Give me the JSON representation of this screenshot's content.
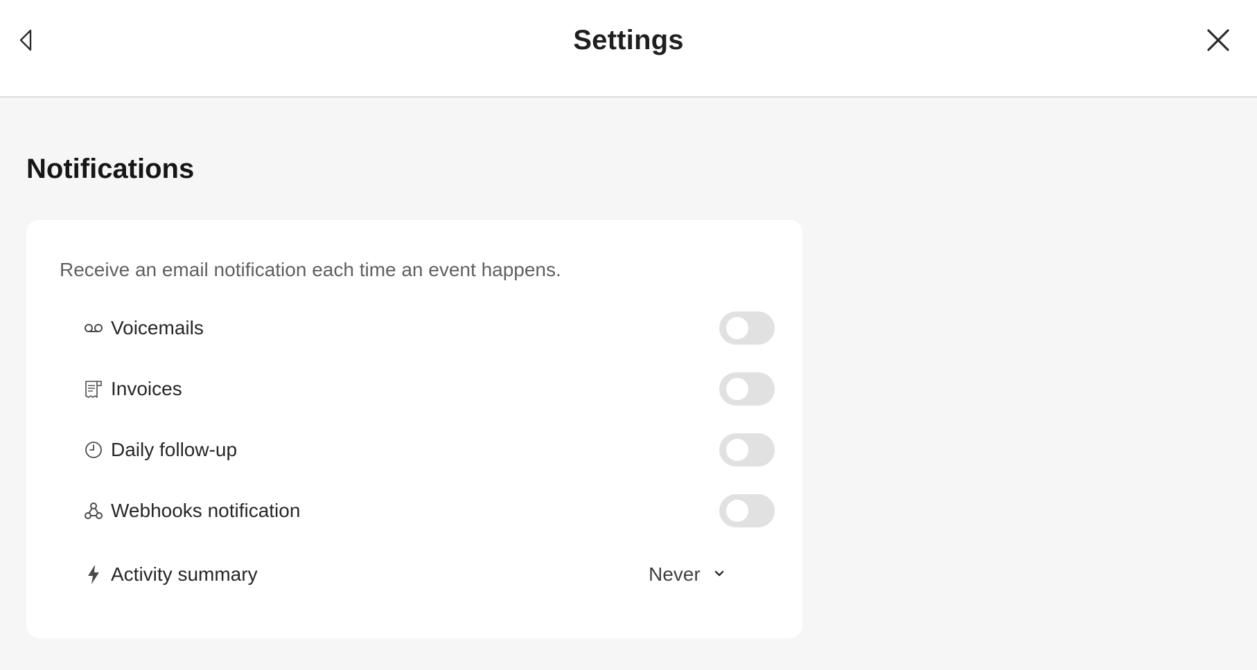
{
  "header": {
    "title": "Settings",
    "back_icon": "chevron-left-icon",
    "close_icon": "close-icon"
  },
  "section": {
    "title": "Notifications"
  },
  "card": {
    "description": "Receive an email notification each time an event happens.",
    "items": [
      {
        "icon": "voicemail-icon",
        "label": "Voicemails",
        "enabled": false
      },
      {
        "icon": "invoice-icon",
        "label": "Invoices",
        "enabled": false
      },
      {
        "icon": "clock-icon",
        "label": "Daily follow-up",
        "enabled": false
      },
      {
        "icon": "webhook-icon",
        "label": "Webhooks notification",
        "enabled": false
      }
    ],
    "activity_summary": {
      "icon": "lightning-icon",
      "label": "Activity summary",
      "value": "Never"
    }
  },
  "colors": {
    "background": "#f6f6f6",
    "surface": "#ffffff",
    "toggle_off": "#e1e1e1",
    "text_primary": "#1f1f1f",
    "text_secondary": "#606060"
  }
}
